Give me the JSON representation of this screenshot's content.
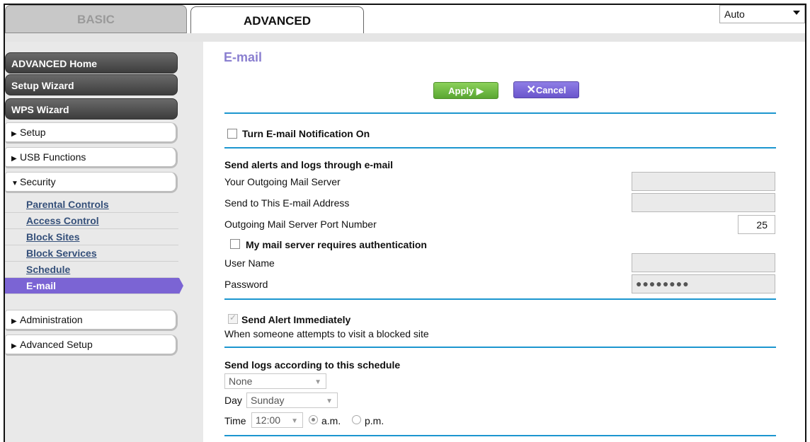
{
  "tabs": {
    "basic": "BASIC",
    "advanced": "ADVANCED"
  },
  "language": {
    "selected": "Auto"
  },
  "sidebar": {
    "advanced_home": "ADVANCED Home",
    "setup_wizard": "Setup Wizard",
    "wps_wizard": "WPS Wizard",
    "setup": "Setup",
    "usb_functions": "USB Functions",
    "security": "Security",
    "security_items": [
      "Parental Controls",
      "Access Control",
      "Block Sites",
      "Block Services",
      "Schedule",
      "E-mail"
    ],
    "administration": "Administration",
    "advanced_setup": "Advanced Setup"
  },
  "page": {
    "title": "E-mail",
    "apply": "Apply ▶",
    "cancel": "Cancel",
    "notification_label": "Turn E-mail Notification On",
    "send_alerts_heading": "Send alerts and logs through e-mail",
    "outgoing_server_label": "Your Outgoing Mail Server",
    "send_to_label": "Send to This E-mail Address",
    "port_label": "Outgoing Mail Server Port Number",
    "port_value": "25",
    "auth_label": "My mail server requires authentication",
    "username_label": "User Name",
    "password_label": "Password",
    "password_value": "●●●●●●●●",
    "send_alert_label": "Send Alert Immediately",
    "send_alert_desc": "When someone attempts to visit a blocked site",
    "schedule_heading": "Send logs according to this schedule",
    "schedule_value": "None",
    "day_label": "Day",
    "day_value": "Sunday",
    "time_label": "Time",
    "time_value": "12:00",
    "am_label": "a.m.",
    "pm_label": "p.m."
  },
  "colors": {
    "accent": "#1c96cf",
    "active_menu": "#7b64d4",
    "title": "#8a7fd0",
    "apply": "#6bb83d",
    "cancel": "#7a66d8"
  }
}
